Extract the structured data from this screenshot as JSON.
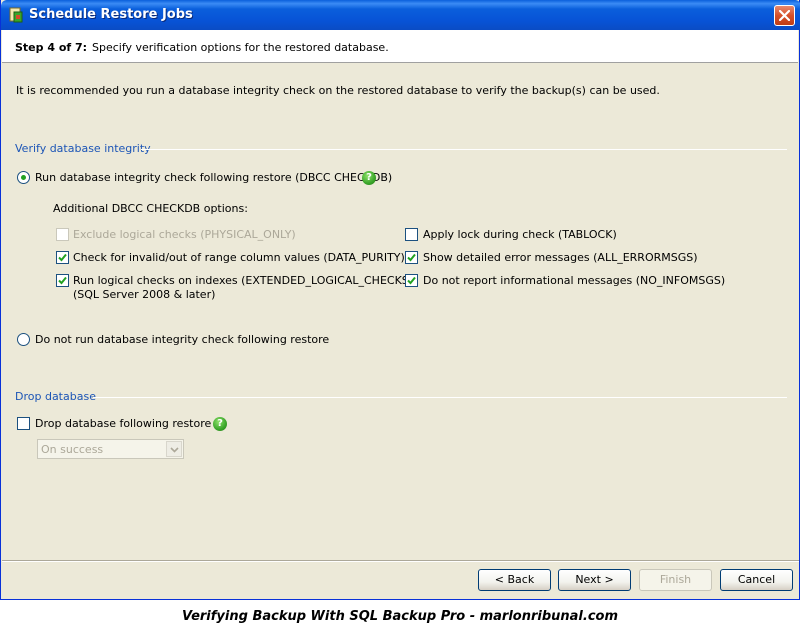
{
  "window": {
    "title": "Schedule Restore Jobs"
  },
  "header": {
    "step": "Step 4 of 7:",
    "description": "Specify verification options for the restored database."
  },
  "intro_text": "It is recommended you run a database integrity check on the restored database to verify the backup(s) can be used.",
  "verify_group": {
    "title": "Verify database integrity",
    "run_check_label": "Run database integrity check following restore  (DBCC CHECKDB)",
    "run_check_selected": true,
    "additional_options_label": "Additional DBCC CHECKDB options:",
    "options": {
      "physical_only": {
        "label": "Exclude logical checks (PHYSICAL_ONLY)",
        "checked": false,
        "enabled": false
      },
      "tablock": {
        "label": "Apply lock during check (TABLOCK)",
        "checked": false,
        "enabled": true
      },
      "data_purity": {
        "label": "Check for invalid/out of range column values (DATA_PURITY)",
        "checked": true,
        "enabled": true
      },
      "all_errormsgs": {
        "label": "Show detailed error messages (ALL_ERRORMSGS)",
        "checked": true,
        "enabled": true
      },
      "extended_logical_line1": "Run logical checks on indexes (EXTENDED_LOGICAL_CHECKS)",
      "extended_logical_line2": "(SQL Server 2008 & later)",
      "extended_logical_checked": true,
      "no_infomsgs": {
        "label": "Do not report informational messages (NO_INFOMSGS)",
        "checked": true,
        "enabled": true
      }
    },
    "no_check_label": "Do not run database integrity check following restore",
    "no_check_selected": false
  },
  "drop_group": {
    "title": "Drop database",
    "drop_label": "Drop database following restore",
    "drop_checked": false,
    "condition_select_value": "On success"
  },
  "buttons": {
    "back": "< Back",
    "next": "Next >",
    "finish": "Finish",
    "cancel": "Cancel"
  },
  "caption": "Verifying Backup With SQL Backup Pro - marlonribunal.com",
  "colors": {
    "titlebar": "#0a5fdc",
    "group_title": "#1c55b6",
    "checkmark": "#21a121",
    "help_icon": "#3aa52a"
  }
}
